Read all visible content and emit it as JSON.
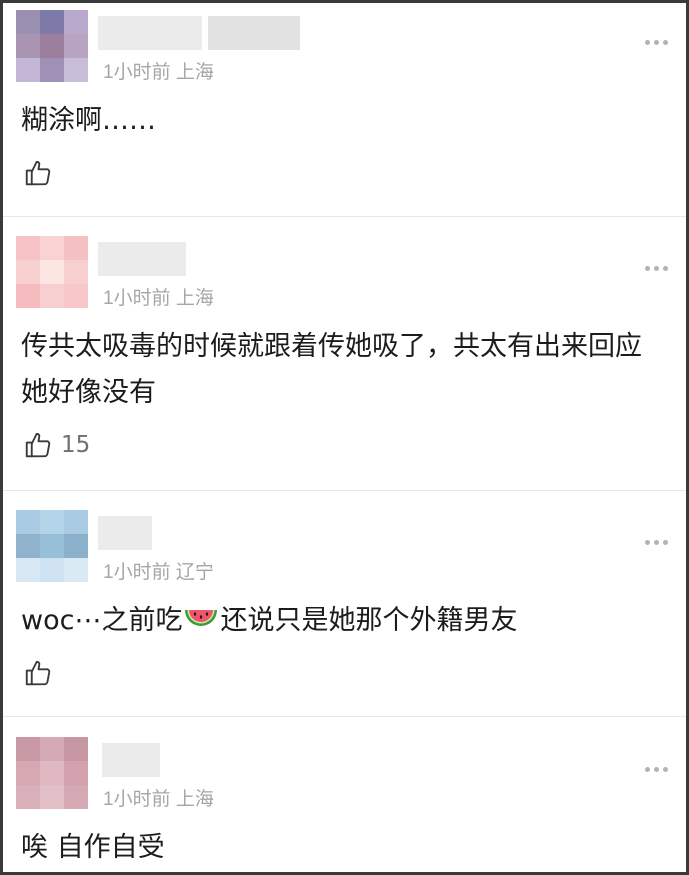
{
  "comments": [
    {
      "time": "1小时前",
      "location": "上海",
      "text": "糊涂啊……",
      "likes": "",
      "avatar_colors": [
        "#9a8fb0",
        "#7e7aa8",
        "#b9aacd",
        "#a994b2",
        "#9c7f9d",
        "#b7a4c2",
        "#c3b6d6",
        "#9f90b6",
        "#c8bdd9"
      ]
    },
    {
      "time": "1小时前",
      "location": "上海",
      "text": "传共太吸毒的时候就跟着传她吸了，共太有出来回应她好像没有",
      "likes": "15",
      "avatar_colors": [
        "#f7c3c6",
        "#f9d3d4",
        "#f5c0c2",
        "#f8d0d0",
        "#fbe6e4",
        "#f7cfcf",
        "#f4bcbf",
        "#f8cfd0",
        "#f6c6c8"
      ]
    },
    {
      "time": "1小时前",
      "location": "辽宁",
      "text_before": "woc⋯之前吃",
      "text_after": "还说只是她那个外籍男友",
      "likes": "",
      "avatar_colors": [
        "#a9cbe4",
        "#b4d4ea",
        "#a8cae3",
        "#8fb3cc",
        "#98bfd8",
        "#8bb0cc",
        "#d7e8f4",
        "#cfe2f1",
        "#d9eaf5"
      ]
    },
    {
      "time": "1小时前",
      "location": "上海",
      "text": "唉 自作自受",
      "likes": "",
      "avatar_colors": [
        "#c99aa5",
        "#d6aab4",
        "#c797a3",
        "#d7a7b2",
        "#e0b8c1",
        "#d3a2ae",
        "#d9afb9",
        "#e3c0c8",
        "#d5a9b4"
      ]
    }
  ],
  "icons": {
    "like": "thumbs-up-outline-icon",
    "more": "more-dots-icon",
    "emoji": "watermelon-emoji"
  }
}
